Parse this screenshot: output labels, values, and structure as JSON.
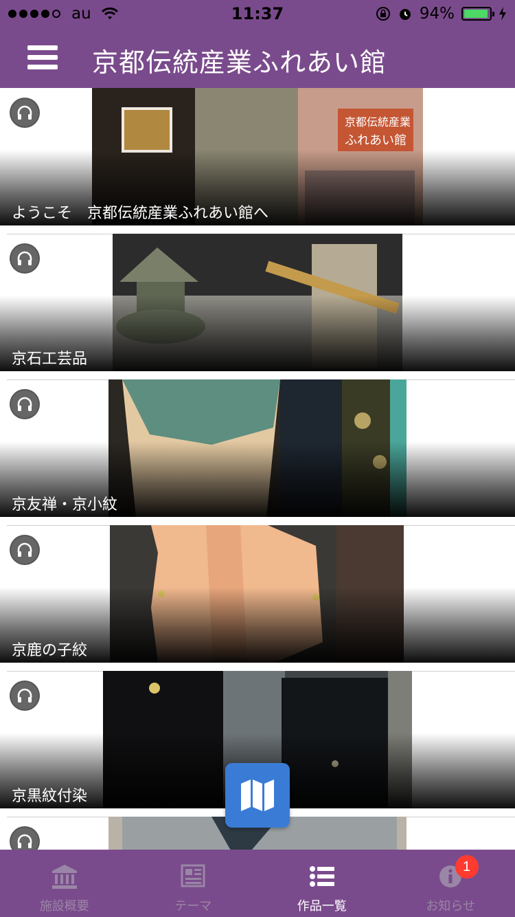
{
  "status_bar": {
    "carrier": "au",
    "time": "11:37",
    "battery_percent": "94%",
    "battery_level": 0.94
  },
  "nav": {
    "title": "京都伝統産業ふれあい館"
  },
  "items": [
    {
      "label": "ようこそ　京都伝統産業ふれあい館へ"
    },
    {
      "label": "京石工芸品"
    },
    {
      "label": "京友禅・京小紋"
    },
    {
      "label": "京鹿の子絞"
    },
    {
      "label": "京黒紋付染"
    },
    {
      "label": ""
    }
  ],
  "tabs": [
    {
      "label": "施設概要",
      "icon": "museum-icon",
      "active": false
    },
    {
      "label": "テーマ",
      "icon": "newspaper-icon",
      "active": false
    },
    {
      "label": "作品一覧",
      "icon": "list-icon",
      "active": true
    },
    {
      "label": "お知らせ",
      "icon": "info-icon",
      "active": false,
      "badge": "1"
    }
  ],
  "colors": {
    "brand_purple": "#7a4b8c",
    "fab_blue": "#3a7bd5",
    "badge_red": "#ff3b30"
  }
}
